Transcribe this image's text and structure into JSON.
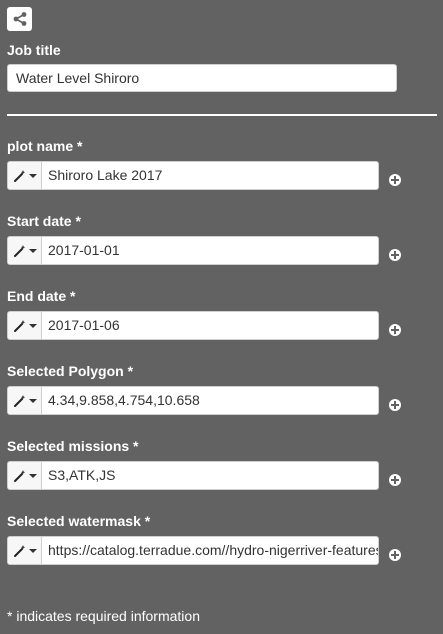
{
  "header": {
    "share_icon": "share-icon"
  },
  "job": {
    "label": "Job title",
    "value": "Water Level Shiroro"
  },
  "fields": [
    {
      "label": "plot name *",
      "value": "Shiroro Lake 2017",
      "icon": "magic-wand-icon"
    },
    {
      "label": "Start date *",
      "value": "2017-01-01",
      "icon": "magic-wand-icon"
    },
    {
      "label": "End date *",
      "value": "2017-01-06",
      "icon": "magic-wand-icon"
    },
    {
      "label": "Selected Polygon *",
      "value": "4.34,9.858,4.754,10.658",
      "icon": "magic-wand-icon"
    },
    {
      "label": "Selected missions *",
      "value": "S3,ATK,JS",
      "icon": "magic-wand-icon"
    },
    {
      "label": "Selected watermask *",
      "value": "https://catalog.terradue.com//hydro-nigerriver-features/search?uid=",
      "icon": "magic-wand-icon"
    }
  ],
  "footer": {
    "note": "* indicates required information"
  }
}
